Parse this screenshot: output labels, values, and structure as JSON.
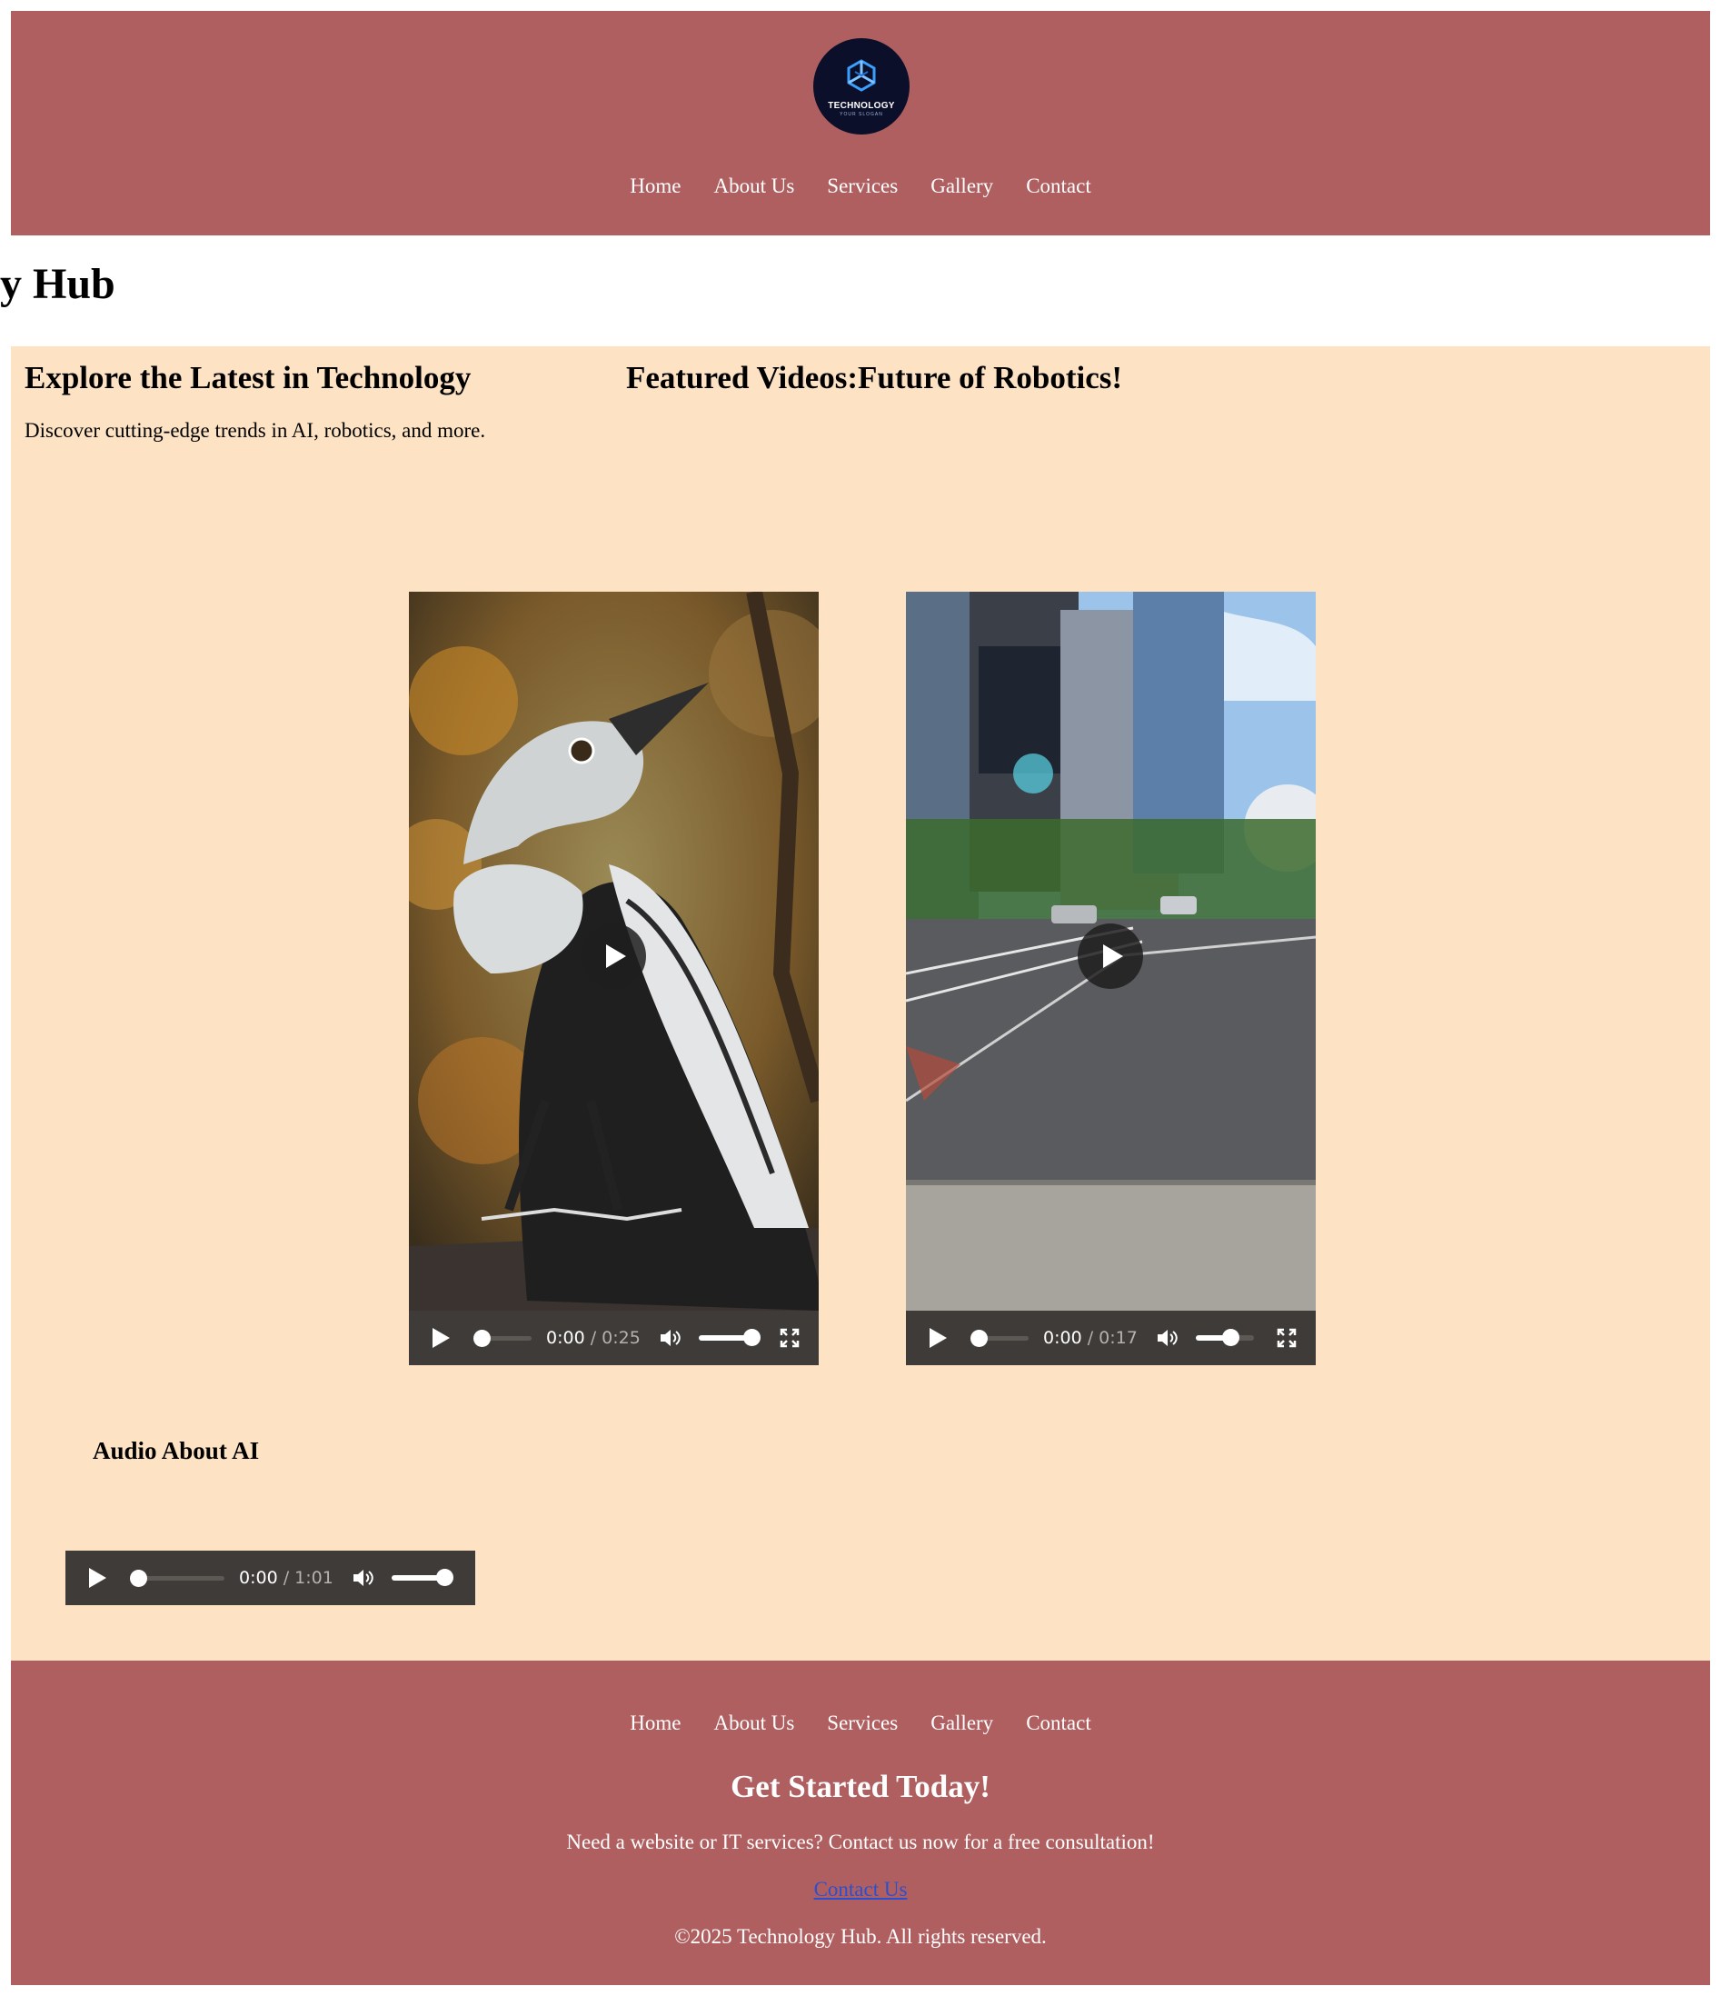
{
  "header": {
    "logo_text": "TECHNOLOGY",
    "logo_slogan": "YOUR SLOGAN",
    "nav": [
      "Home",
      "About Us",
      "Services",
      "Gallery",
      "Contact"
    ]
  },
  "site_title": "gy Hub",
  "main": {
    "heading": "Explore the Latest in Technology",
    "lead": "Discover cutting-edge trends in AI, robotics, and more.",
    "featured_heading": "Featured Videos:Future of Robotics!",
    "videos": [
      {
        "current": "0:00",
        "duration": "0:25",
        "volume_percent": 100
      },
      {
        "current": "0:00",
        "duration": "0:17",
        "volume_percent": 60
      }
    ],
    "audio_heading": "Audio About AI",
    "audio": {
      "current": "0:00",
      "duration": "1:01",
      "volume_percent": 100
    }
  },
  "footer": {
    "nav": [
      "Home",
      "About Us",
      "Services",
      "Gallery",
      "Contact"
    ],
    "heading": "Get Started Today!",
    "cta_text": "Need a website or IT services? Contact us now for a free consultation!",
    "contact_link": "Contact Us",
    "copyright": "©2025 Technology Hub. All rights reserved."
  },
  "colors": {
    "header_footer_bg": "#b05f60",
    "main_bg": "#fde3c3",
    "link": "#2a4fd0",
    "player_bar": "#3e3b38"
  }
}
